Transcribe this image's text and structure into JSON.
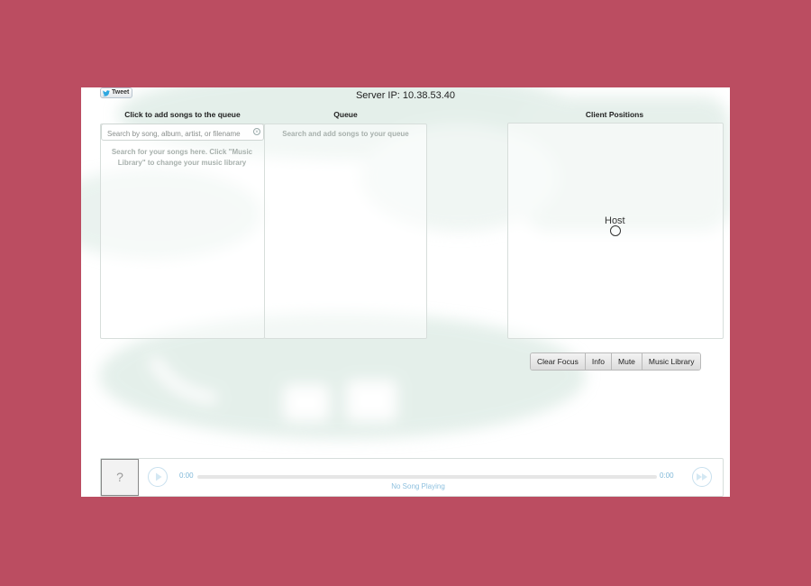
{
  "header": {
    "tweet_label": "Tweet",
    "server_ip": "Server IP: 10.38.53.40"
  },
  "library": {
    "title": "Click to add songs to the queue",
    "search_placeholder": "Search by song, album, artist, or filename",
    "hint": "Search for your songs here. Click \"Music Library\" to change your music library"
  },
  "queue": {
    "title": "Queue",
    "hint": "Search and add songs to your queue"
  },
  "clients": {
    "title": "Client Positions",
    "host_label": "Host"
  },
  "controls": {
    "clear_focus": "Clear Focus",
    "info": "Info",
    "mute": "Mute",
    "music_library": "Music Library"
  },
  "player": {
    "album_placeholder": "?",
    "elapsed": "0:00",
    "duration": "0:00",
    "progress": 0,
    "now_playing": "No Song Playing"
  },
  "colors": {
    "page_background": "#bb4d61",
    "accent": "#7fb8d8"
  }
}
